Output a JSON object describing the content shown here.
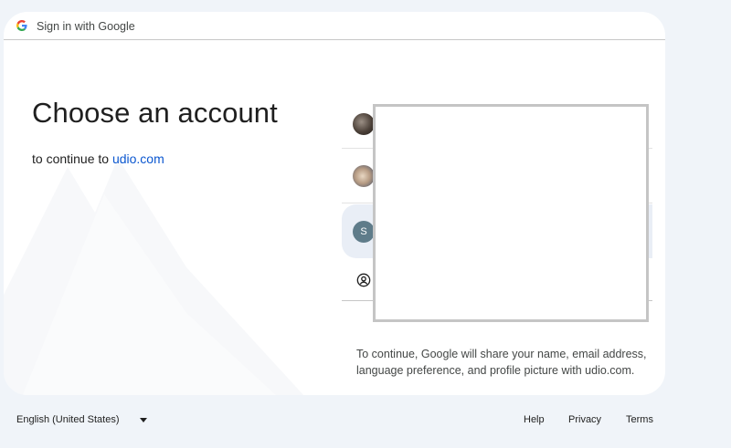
{
  "header": {
    "title": "Sign in with Google",
    "logo_icon": "google-g-icon"
  },
  "main": {
    "heading": "Choose an account",
    "subtitle_prefix": "to continue to ",
    "subtitle_link": "udio.com"
  },
  "accounts": [
    {
      "avatar": "photo",
      "icon": "user-photo-avatar"
    },
    {
      "avatar": "photo",
      "icon": "user-photo-avatar"
    },
    {
      "avatar_letter": "S",
      "avatar_color": "#5f7c8a"
    },
    {
      "icon": "account-circle-icon"
    }
  ],
  "consent_text": "To continue, Google will share your name, email address, language preference, and profile picture with udio.com.",
  "footer": {
    "language": "English (United States)",
    "help": "Help",
    "privacy": "Privacy",
    "terms": "Terms"
  },
  "colors": {
    "background": "#f0f4f9",
    "card": "#ffffff",
    "link": "#0b57d0",
    "selected_row": "#e9eef6"
  }
}
